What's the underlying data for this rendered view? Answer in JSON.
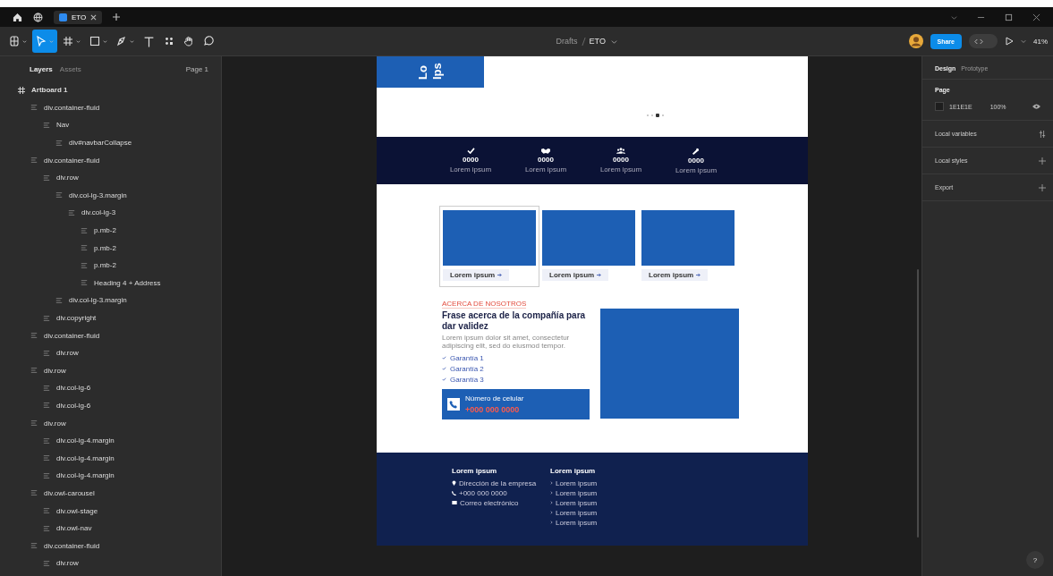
{
  "tabs_bar": {
    "tabs": [
      {
        "label": "ETO",
        "selected": true
      }
    ]
  },
  "toolbar": {
    "tools": [
      {
        "kind": "main-menu",
        "selected": false
      },
      {
        "kind": "move",
        "selected": true
      },
      {
        "kind": "frame",
        "selected": false
      },
      {
        "kind": "shape",
        "selected": false
      },
      {
        "kind": "pen",
        "selected": false
      },
      {
        "kind": "text",
        "selected": false
      },
      {
        "kind": "resources",
        "selected": false
      },
      {
        "kind": "hand",
        "selected": false
      },
      {
        "kind": "comment",
        "selected": false
      }
    ],
    "breadcrumb": {
      "parent": "Drafts",
      "current": "ETO"
    },
    "share": "Share",
    "dev_mode": false,
    "zoom": "41%"
  },
  "layers_panel": {
    "tabs": [
      {
        "label": "Layers",
        "selected": true
      },
      {
        "label": "Assets",
        "selected": false
      }
    ],
    "page": "Page 1",
    "tree": [
      {
        "name": "Artboard 1",
        "kind": "frame",
        "children": [
          {
            "name": "div.container-fluid",
            "kind": "stack",
            "children": [
              {
                "name": "Nav",
                "kind": "stack",
                "children": [
                  {
                    "name": "div#navbarCollapse",
                    "kind": "stack"
                  }
                ]
              }
            ]
          },
          {
            "name": "div.container-fluid",
            "kind": "stack",
            "children": [
              {
                "name": "div.row",
                "kind": "stack",
                "children": [
                  {
                    "name": "div.col-lg-3.margin",
                    "kind": "stack",
                    "children": [
                      {
                        "name": "div.col-lg-3",
                        "kind": "stack",
                        "children": [
                          {
                            "name": "p.mb-2",
                            "kind": "stack"
                          },
                          {
                            "name": "p.mb-2",
                            "kind": "stack"
                          },
                          {
                            "name": "p.mb-2",
                            "kind": "stack"
                          },
                          {
                            "name": "Heading 4 + Address",
                            "kind": "stack"
                          }
                        ]
                      }
                    ]
                  },
                  {
                    "name": "div.col-lg-3.margin",
                    "kind": "stack"
                  }
                ]
              },
              {
                "name": "div.copyright",
                "kind": "stack"
              }
            ]
          },
          {
            "name": "div.container-fluid",
            "kind": "stack",
            "children": [
              {
                "name": "div.row",
                "kind": "stack"
              }
            ]
          },
          {
            "name": "div.row",
            "kind": "stack",
            "children": [
              {
                "name": "div.col-lg-6",
                "kind": "stack"
              },
              {
                "name": "div.col-lg-6",
                "kind": "stack"
              }
            ]
          },
          {
            "name": "div.row",
            "kind": "stack",
            "children": [
              {
                "name": "div.col-lg-4.margin",
                "kind": "stack"
              },
              {
                "name": "div.col-lg-4.margin",
                "kind": "stack"
              },
              {
                "name": "div.col-lg-4.margin",
                "kind": "stack"
              }
            ]
          },
          {
            "name": "div.owl-carousel",
            "kind": "stack",
            "children": [
              {
                "name": "div.owl-stage",
                "kind": "stack"
              },
              {
                "name": "div.owl-nav",
                "kind": "stack"
              }
            ]
          },
          {
            "name": "div.container-fluid",
            "kind": "stack",
            "children": [
              {
                "name": "div.row",
                "kind": "stack"
              }
            ]
          }
        ]
      }
    ]
  },
  "design_panel": {
    "tabs": [
      {
        "label": "Design",
        "selected": true
      },
      {
        "label": "Prototype",
        "selected": false
      }
    ],
    "section": "Page",
    "color": "1E1E1E",
    "opacity": "100%",
    "rows": [
      {
        "label": "Local variables",
        "kind": "variables"
      },
      {
        "label": "Local styles",
        "kind": "add"
      },
      {
        "label": "Export",
        "kind": "add"
      }
    ]
  },
  "artboard": {
    "hero": {
      "title_lines": [
        "Lo",
        "Ips"
      ],
      "dots": [
        {
          "selected": false
        },
        {
          "selected": false
        },
        {
          "selected": true
        },
        {
          "selected": false
        }
      ]
    },
    "stats": [
      {
        "kind": "check",
        "value": "0000",
        "label": "Lorem ipsum"
      },
      {
        "kind": "hands",
        "value": "0000",
        "label": "Lorem ipsum"
      },
      {
        "kind": "users",
        "value": "0000",
        "label": "Lorem ipsum"
      },
      {
        "kind": "wrench",
        "value": "0000",
        "label": "Lorem ipsum"
      }
    ],
    "cards": [
      {
        "label": "Lorem ipsum",
        "selected": true
      },
      {
        "label": "Lorem ipsum",
        "selected": false
      },
      {
        "label": "Lorem ipsum",
        "selected": false
      }
    ],
    "about": {
      "tag": "ACERCA DE NOSOTROS",
      "heading": "Frase acerca de la compañía para dar validez",
      "text": "Lorem ipsum dolor sit amet, consectetur adipiscing elit, sed do eiusmod tempor.",
      "checklist": [
        "Garantía 1",
        "Garantía 2",
        "Garantía 3"
      ],
      "phone_label": "Número de celular",
      "phone": "+000 000 0000"
    },
    "footer": {
      "columns": [
        {
          "title": "Lorem ipsum",
          "kind": "contact",
          "items": [
            {
              "kind": "pin",
              "text": "Dirección de la empresa"
            },
            {
              "kind": "phone",
              "text": "+000 000 0000"
            },
            {
              "kind": "mail",
              "text": "Correo electrónico"
            }
          ]
        },
        {
          "title": "Lorem ipsum",
          "kind": "links",
          "items": [
            "Lorem ipsum",
            "Lorem ipsum",
            "Lorem ipsum",
            "Lorem ipsum",
            "Lorem ipsum"
          ]
        }
      ]
    }
  },
  "help": "?"
}
